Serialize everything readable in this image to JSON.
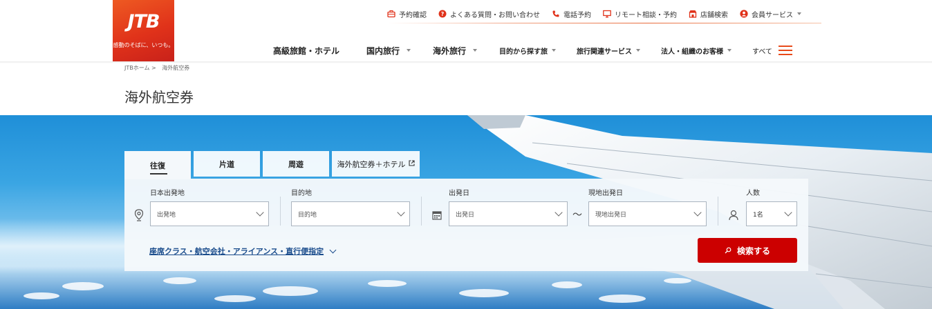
{
  "logo": {
    "mark": "JTB",
    "tagline": "感動のそばに、いつも。"
  },
  "util_nav": [
    {
      "label": "予約確認",
      "icon": "briefcase-icon"
    },
    {
      "label": "よくある質問・お問い合わせ",
      "icon": "question-icon"
    },
    {
      "label": "電話予約",
      "icon": "phone-icon"
    },
    {
      "label": "リモート相談・予約",
      "icon": "monitor-icon"
    },
    {
      "label": "店舗検索",
      "icon": "store-icon"
    },
    {
      "label": "会員サービス",
      "icon": "user-icon"
    }
  ],
  "global_nav": [
    {
      "label": "高級旅館・ホテル",
      "dropdown": false
    },
    {
      "label": "国内旅行",
      "dropdown": true
    },
    {
      "label": "海外旅行",
      "dropdown": true
    },
    {
      "label": "目的から探す旅",
      "dropdown": true
    },
    {
      "label": "旅行関連サービス",
      "dropdown": true
    },
    {
      "label": "法人・組織のお客様",
      "dropdown": true
    },
    {
      "label": "すべて",
      "dropdown": false
    }
  ],
  "breadcrumb": {
    "home": "JTBホーム",
    "separator": ">",
    "current": "海外航空券"
  },
  "page_title": "海外航空券",
  "tabs": [
    {
      "label": "往復",
      "active": true
    },
    {
      "label": "片道",
      "active": false
    },
    {
      "label": "周遊",
      "active": false
    },
    {
      "label": "海外航空券＋ホテル",
      "active": false,
      "external": true
    }
  ],
  "form": {
    "origin": {
      "label": "日本出発地",
      "placeholder": "出発地"
    },
    "destination": {
      "label": "目的地",
      "placeholder": "目的地"
    },
    "depart": {
      "label": "出発日",
      "placeholder": "出発日"
    },
    "tilde": "～",
    "local_depart": {
      "label": "現地出発日",
      "placeholder": "現地出発日"
    },
    "pax": {
      "label": "人数",
      "value": "1名"
    },
    "options_link": "座席クラス・航空会社・アライアンス・直行便指定",
    "search_button": "検索する"
  },
  "colors": {
    "brand": "#e0321a",
    "search": "#cc0000",
    "link": "#1a4c8c"
  }
}
